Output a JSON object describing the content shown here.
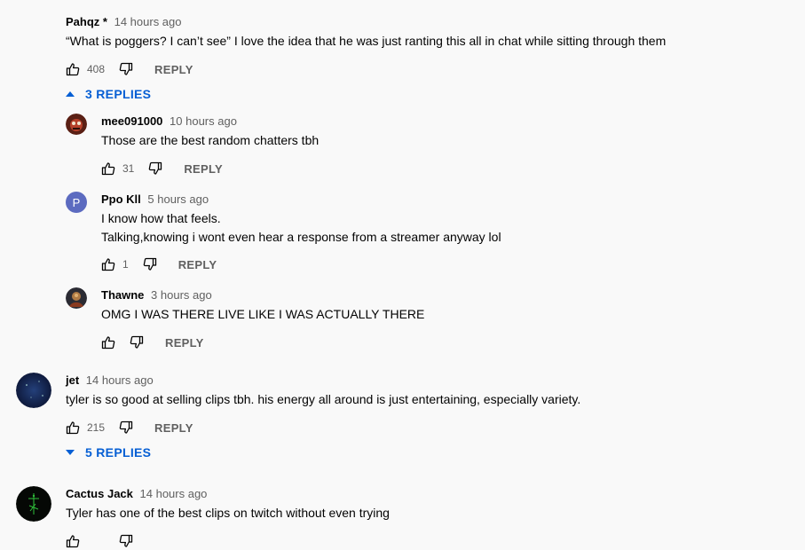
{
  "comments": [
    {
      "author": "Pahqz",
      "author_suffix": "*",
      "time": "14 hours ago",
      "text": "“What is poggers? I can’t see” I love the idea that he was just ranting this all in chat while sitting through them",
      "likes": "408",
      "reply_label": "REPLY",
      "replies_toggle": "3 REPLIES",
      "replies": [
        {
          "author": "mee091000",
          "time": "10 hours ago",
          "lines": [
            "Those are the best random chatters tbh"
          ],
          "likes": "31",
          "reply_label": "REPLY"
        },
        {
          "author": "Ppo Kll",
          "avatar_letter": "P",
          "time": "5 hours ago",
          "lines": [
            "I know how that feels.",
            "Talking,knowing i wont even hear a response from a streamer anyway lol"
          ],
          "likes": "1",
          "reply_label": "REPLY"
        },
        {
          "author": "Thawne",
          "time": "3 hours ago",
          "lines": [
            "OMG I WAS THERE LIVE LIKE I WAS ACTUALLY THERE"
          ],
          "likes": "",
          "reply_label": "REPLY"
        }
      ]
    },
    {
      "author": "jet",
      "time": "14 hours ago",
      "text": "tyler is so good at selling clips tbh. his energy all around is just entertaining, especially variety.",
      "likes": "215",
      "reply_label": "REPLY",
      "replies_toggle": "5 REPLIES"
    },
    {
      "author": "Cactus Jack",
      "time": "14 hours ago",
      "text": "Tyler has one of the best clips on twitch without even trying"
    }
  ],
  "colors": {
    "link_blue": "#065fd4",
    "muted": "#606060",
    "text": "#030303",
    "avatar_p": "#5c6bc0"
  },
  "icons": {
    "like": "thumb-up-icon",
    "dislike": "thumb-down-icon",
    "expand": "caret-icon"
  }
}
